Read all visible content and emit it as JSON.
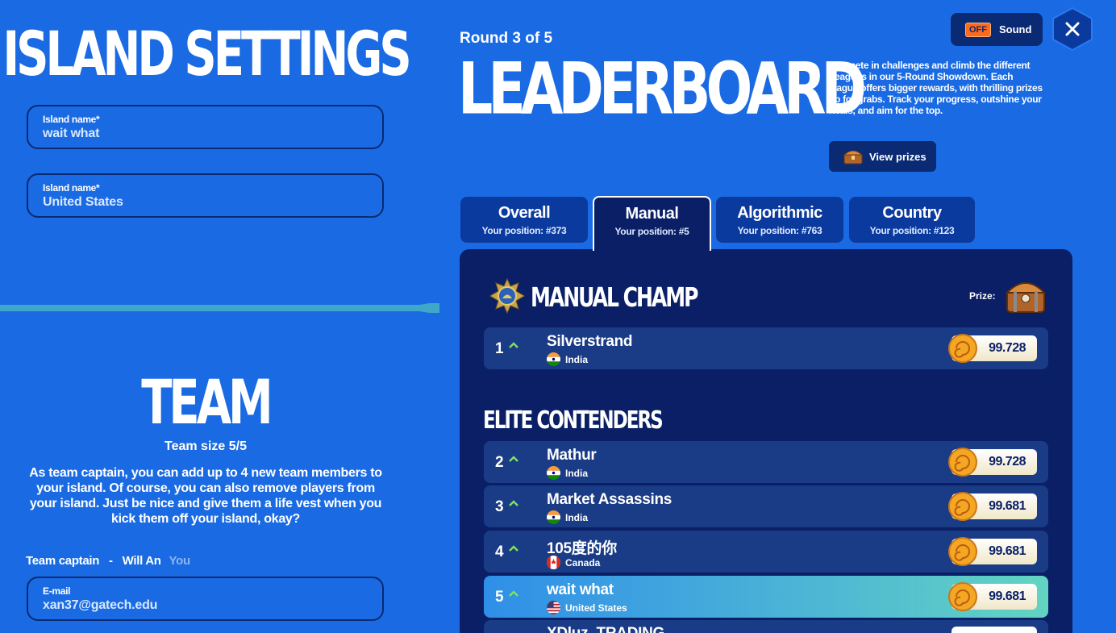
{
  "island_settings": {
    "title": "ISLAND SETTINGS",
    "fields": [
      {
        "label": "Island name*",
        "value": "wait what"
      },
      {
        "label": "Island name*",
        "value": "United States"
      }
    ]
  },
  "team": {
    "title": "TEAM",
    "size_text": "Team size 5/5",
    "description": "As team captain, you can add up to 4 new team members to your island. Of course, you can also remove players from your island. Just be nice and give them a life vest when you kick them off your island, okay?",
    "captain_label": "Team captain",
    "captain_sep": "-",
    "captain_name": "Will An",
    "you_label": "You",
    "email_label": "E-mail",
    "email_value": "xan37@gatech.edu"
  },
  "header": {
    "round": "Round 3 of 5",
    "title": "LEADERBOARD",
    "description": "Compete in challenges and climb the different Leagues in our 5-Round Showdown. Each league offers bigger rewards, with thrilling prizes up for grabs. Track your progress, outshine your rivals, and aim for the top.",
    "view_prizes": "View prizes",
    "sound_state": "OFF",
    "sound_label": "Sound"
  },
  "tabs": [
    {
      "name": "Overall",
      "position": "Your position: #373"
    },
    {
      "name": "Manual",
      "position": "Your position: #5"
    },
    {
      "name": "Algorithmic",
      "position": "Your position: #763"
    },
    {
      "name": "Country",
      "position": "Your position: #123"
    }
  ],
  "board": {
    "champ_title": "MANUAL CHAMP",
    "prize_label": "Prize:",
    "elite_title": "ELITE CONTENDERS",
    "rows": [
      {
        "rank": "1",
        "name": "Silverstrand",
        "country": "India",
        "score": "99.728"
      },
      {
        "rank": "2",
        "name": "Mathur",
        "country": "India",
        "score": "99.728"
      },
      {
        "rank": "3",
        "name": "Market Assassins",
        "country": "India",
        "score": "99.681"
      },
      {
        "rank": "4",
        "name": "105度的你",
        "country": "Canada",
        "score": "99.681"
      },
      {
        "rank": "5",
        "name": "wait what",
        "country": "United States",
        "score": "99.681"
      },
      {
        "rank": "",
        "name": "XDluz_TRADING",
        "country": "",
        "score": ""
      }
    ]
  },
  "colors": {
    "background": "#1a6be3",
    "panel": "#0a1f66",
    "row": "#1a3b85",
    "accent_orange": "#ff6a1a",
    "arrow_green": "#7ee25a"
  }
}
